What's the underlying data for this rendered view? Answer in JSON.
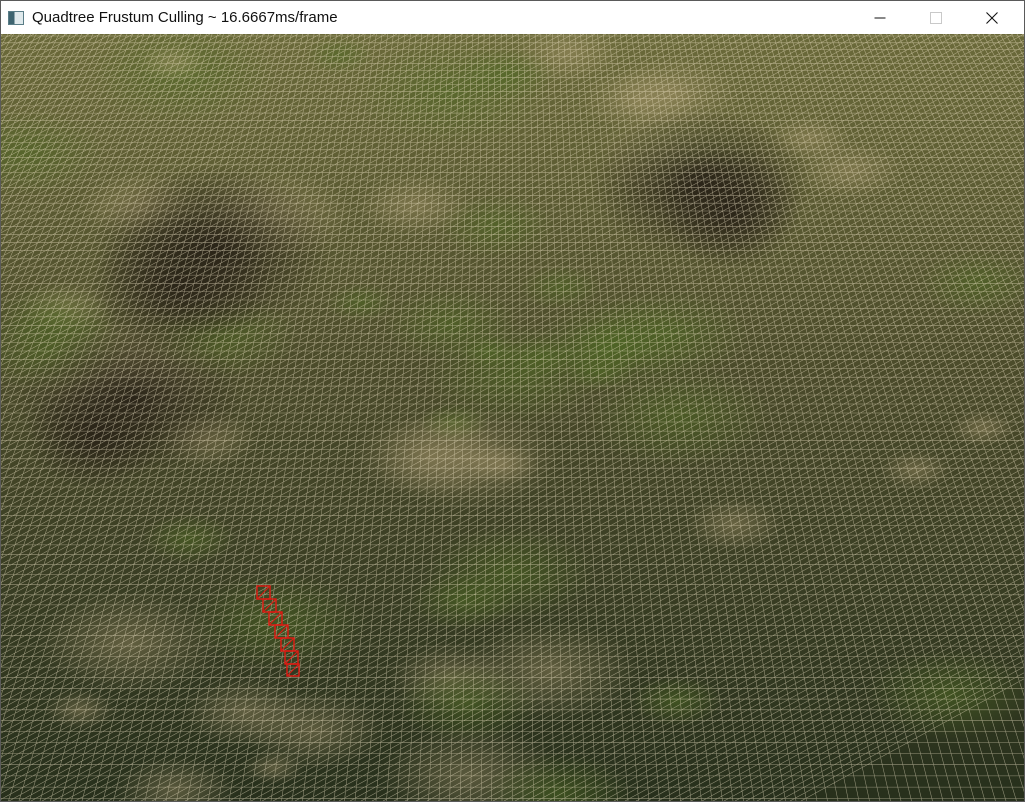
{
  "window": {
    "title": "Quadtree Frustum Culling ~ 16.6667ms/frame",
    "app_icon": "app-window-icon",
    "controls": [
      {
        "name": "minimize",
        "icon": "minimize-icon"
      },
      {
        "name": "maximize",
        "icon": "maximize-icon",
        "enabled": false
      },
      {
        "name": "close",
        "icon": "close-icon"
      }
    ]
  },
  "scene": {
    "kind": "wireframe-terrain",
    "colors": {
      "sky_band": "#6b6a3a",
      "ground_near": "#27301c",
      "ground_mid": "#4a4a2a",
      "grass": "#4f6a24",
      "rock": "#2a2418",
      "wire": "#f1e6c8",
      "culling_highlight": "#e01a12"
    }
  }
}
